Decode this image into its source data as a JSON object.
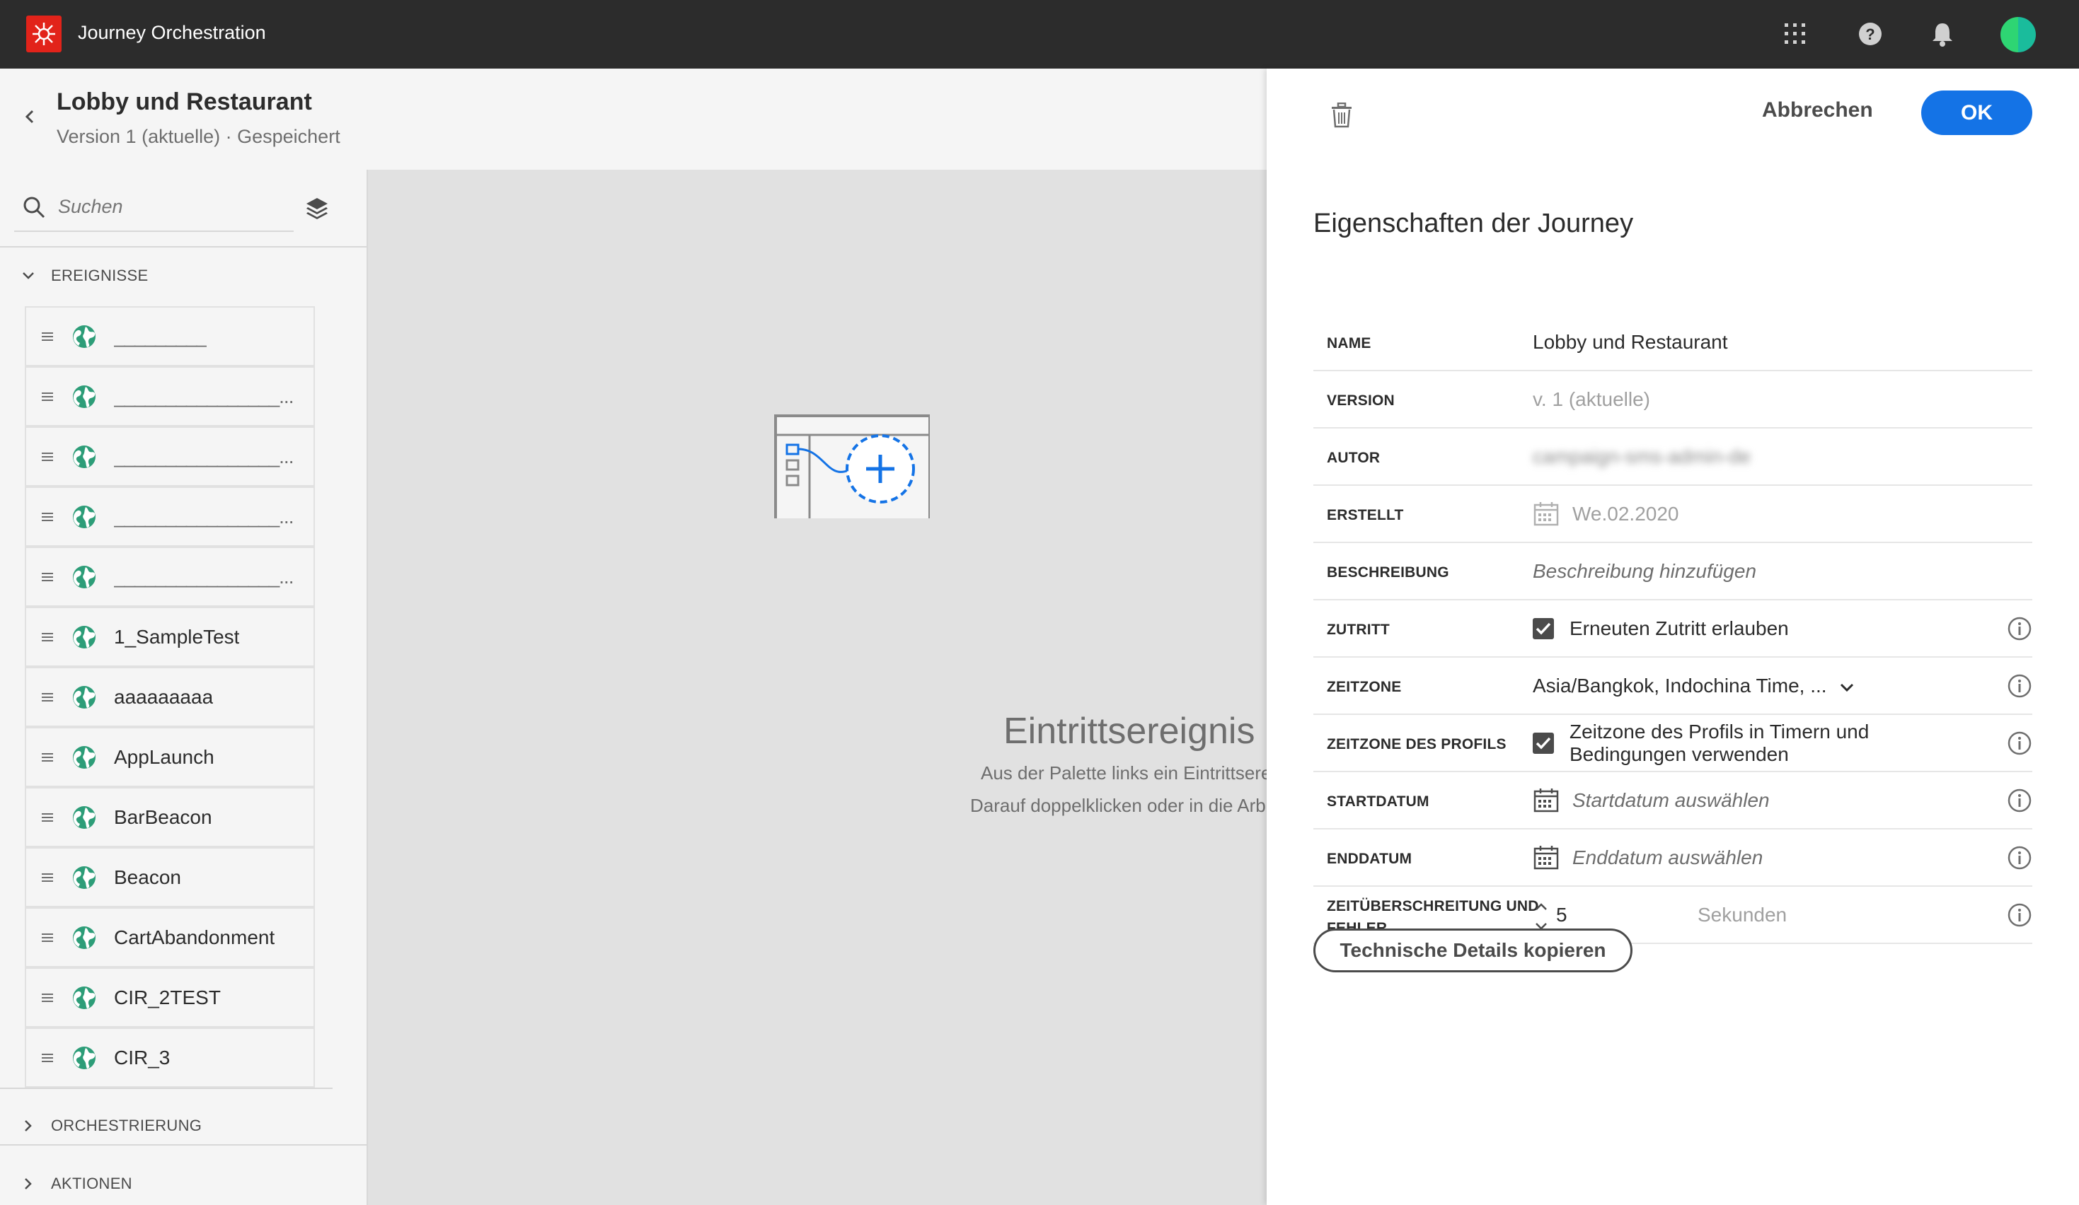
{
  "app": {
    "title": "Journey Orchestration"
  },
  "header": {
    "journey_name": "Lobby und Restaurant",
    "status": "Version 1 (aktuelle) · Gespeichert"
  },
  "palette": {
    "search_placeholder": "Suchen",
    "sections": {
      "events": "EREIGNISSE",
      "orchestration": "ORCHESTRIERUNG",
      "actions": "AKTIONEN"
    },
    "events": [
      {
        "label": "_________"
      },
      {
        "label": "________________..."
      },
      {
        "label": "________________..."
      },
      {
        "label": "________________..."
      },
      {
        "label": "________________..."
      },
      {
        "label": "1_SampleTest"
      },
      {
        "label": "aaaaaaaaa"
      },
      {
        "label": "AppLaunch"
      },
      {
        "label": "BarBeacon"
      },
      {
        "label": "Beacon"
      },
      {
        "label": "CartAbandonment"
      },
      {
        "label": "CIR_2TEST"
      },
      {
        "label": "CIR_3"
      }
    ]
  },
  "canvas": {
    "title": "Eintrittsereignis",
    "hint_line1": "Aus der Palette links ein Eintrittserei",
    "hint_line2": "Darauf doppelklicken oder in die Arb"
  },
  "panel": {
    "cancel_label": "Abbrechen",
    "ok_label": "OK",
    "title": "Eigenschaften der Journey",
    "properties": {
      "name": {
        "label": "NAME",
        "value": "Lobby und Restaurant"
      },
      "version": {
        "label": "VERSION",
        "value": "v. 1 (aktuelle)"
      },
      "author": {
        "label": "AUTOR",
        "value": "campaign-sms-admin-de"
      },
      "created": {
        "label": "ERSTELLT",
        "value": "We.02.2020"
      },
      "description": {
        "label": "BESCHREIBUNG",
        "placeholder": "Beschreibung hinzufügen"
      },
      "reentry": {
        "label": "ZUTRITT",
        "value": "Erneuten Zutritt erlauben",
        "checked": true
      },
      "timezone": {
        "label": "ZEITZONE",
        "value": "Asia/Bangkok, Indochina Time, ..."
      },
      "profile_timezone": {
        "label": "ZEITZONE DES PROFILS",
        "value_line1": "Zeitzone des Profils in Timern und",
        "value_line2": "Bedingungen verwenden",
        "checked": true
      },
      "start_date": {
        "label": "STARTDATUM",
        "placeholder": "Startdatum auswählen"
      },
      "end_date": {
        "label": "ENDDATUM",
        "placeholder": "Enddatum auswählen"
      },
      "timeout": {
        "label_line1": "ZEITÜBERSCHREITUNG UND",
        "label_line2": "FEHLER",
        "value": "5",
        "unit": "Sekunden"
      }
    },
    "copy_button": "Technische Details kopieren"
  },
  "colors": {
    "topbar": "#2c2c2c",
    "brand_red": "#e2231a",
    "accent_blue": "#1473e6",
    "globe_green": "#2d9d78"
  }
}
